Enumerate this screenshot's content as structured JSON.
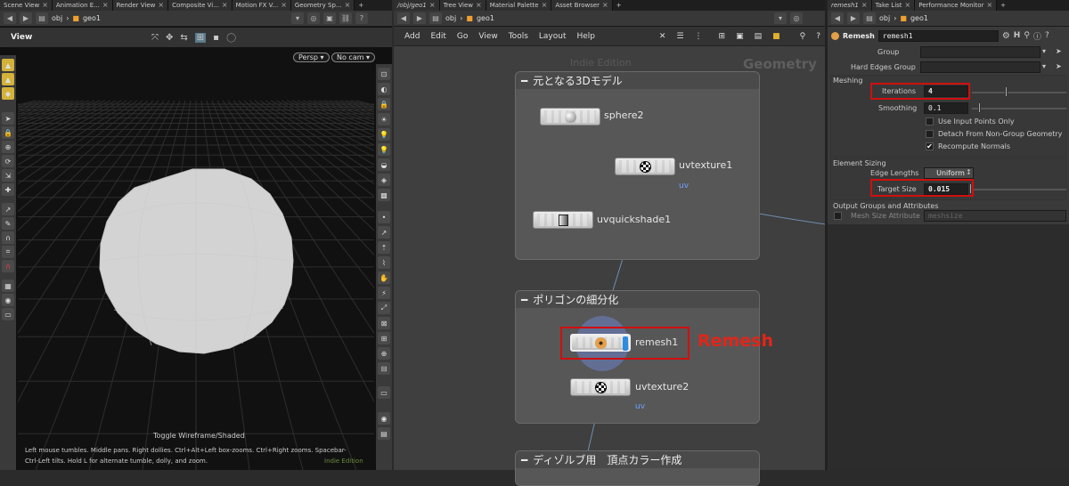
{
  "left_pane": {
    "tabs": [
      "Scene View",
      "Animation E...",
      "Render View",
      "Composite Vi...",
      "Motion FX V...",
      "Geometry Sp..."
    ],
    "path": {
      "root": "obj",
      "node": "geo1"
    },
    "view_label": "View",
    "persp_button": "Persp ▾",
    "cam_button": "No cam ▾",
    "toggle_text": "Toggle Wireframe/Shaded",
    "help_text_1": "Left mouse tumbles. Middle pans. Right dollies. Ctrl+Alt+Left box-zooms. Ctrl+Right zooms. Spacebar-",
    "help_text_2": "Ctrl-Left tilts. Hold L for alternate tumble, dolly, and zoom.",
    "watermark": "Indie Edition"
  },
  "mid_pane": {
    "tabs": [
      "/obj/geo1",
      "Tree View",
      "Material Palette",
      "Asset Browser"
    ],
    "path": {
      "root": "obj",
      "node": "geo1"
    },
    "menu": [
      "Add",
      "Edit",
      "Go",
      "View",
      "Tools",
      "Layout",
      "Help"
    ],
    "watermark": "Indie Edition",
    "context_label": "Geometry",
    "box1_title": "元となる3Dモデル",
    "box2_title": "ポリゴンの細分化",
    "box3_title": "ディゾルブ用　頂点カラー作成",
    "nodes": {
      "sphere": "sphere2",
      "uvtexture1": "uvtexture1",
      "uvtexture1_sub": "uv",
      "uvquickshade": "uvquickshade1",
      "remesh": "remesh1",
      "uvtexture2": "uvtexture2",
      "uvtexture2_sub": "uv"
    },
    "annotation": "Remesh"
  },
  "right_pane": {
    "tabs": [
      "remesh1",
      "Take List",
      "Performance Monitor"
    ],
    "path": {
      "root": "obj",
      "node": "geo1"
    },
    "node_type": "Remesh",
    "node_name": "remesh1",
    "params": {
      "group_label": "Group",
      "hard_edges_label": "Hard Edges Group",
      "meshing_section": "Meshing",
      "iterations_label": "Iterations",
      "iterations_value": "4",
      "smoothing_label": "Smoothing",
      "smoothing_value": "0.1",
      "use_input_points": "Use Input Points Only",
      "detach": "Detach From Non-Group Geometry",
      "recompute": "Recompute Normals",
      "element_sizing": "Element Sizing",
      "edge_lengths_label": "Edge Lengths",
      "edge_lengths_value": "Uniform",
      "target_size_label": "Target Size",
      "target_size_value": "0.015",
      "output_section": "Output Groups and Attributes",
      "mesh_size_label": "Mesh Size Attribute",
      "mesh_size_value": "meshsize"
    }
  },
  "colors": {
    "highlight_red": "#d10f0f",
    "annotation_red": "#e0261a",
    "uv_blue": "#6fa3ff"
  }
}
